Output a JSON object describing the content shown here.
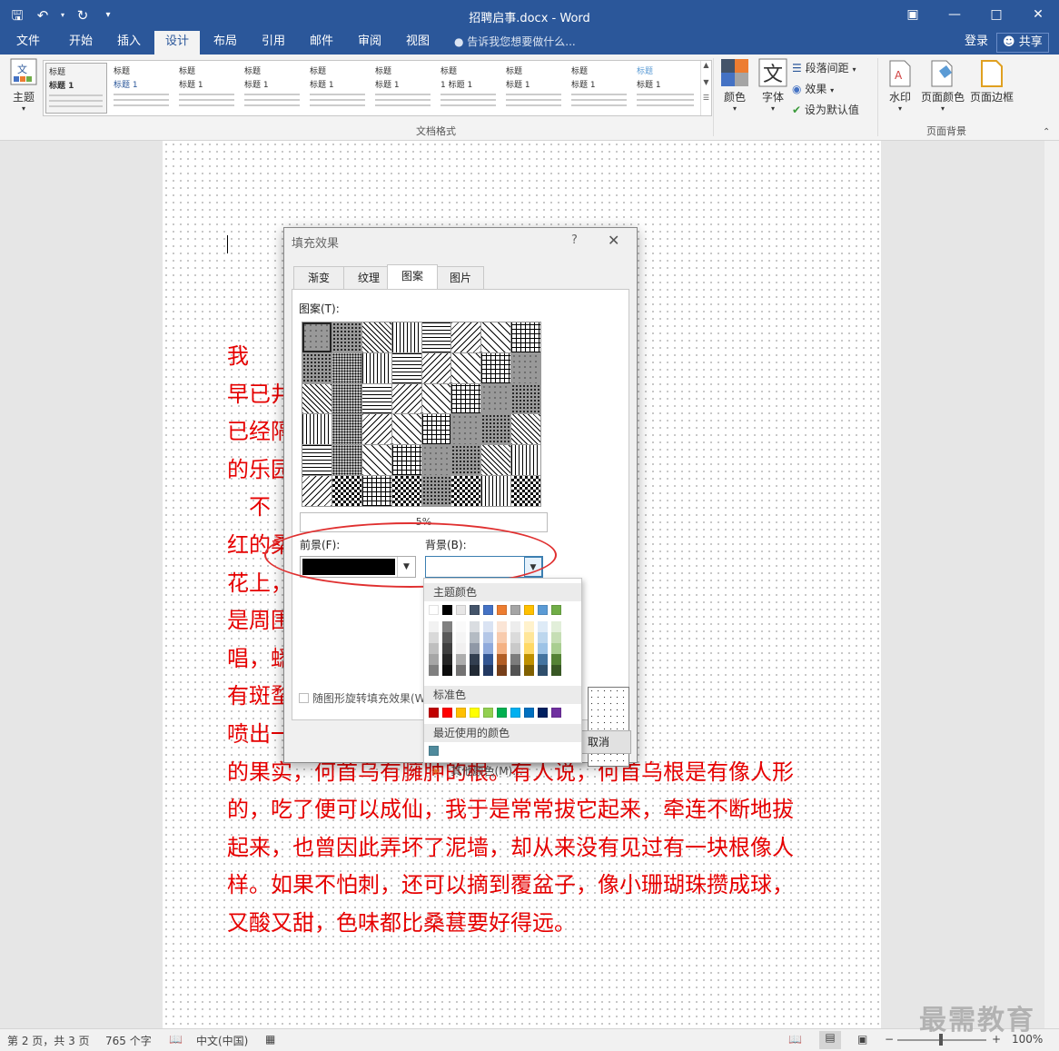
{
  "app": {
    "title": "招聘启事.docx - Word",
    "quick_access": [
      "save-icon",
      "undo-icon",
      "redo-icon",
      "customize-icon"
    ],
    "window_controls": [
      "restore-ribbon-icon",
      "minimize-icon",
      "maximize-icon",
      "close-icon"
    ]
  },
  "tabs": [
    {
      "label": "文件",
      "active": false
    },
    {
      "label": "开始",
      "active": false
    },
    {
      "label": "插入",
      "active": false
    },
    {
      "label": "设计",
      "active": true
    },
    {
      "label": "布局",
      "active": false
    },
    {
      "label": "引用",
      "active": false
    },
    {
      "label": "邮件",
      "active": false
    },
    {
      "label": "审阅",
      "active": false
    },
    {
      "label": "视图",
      "active": false
    }
  ],
  "tellme": "告诉我您想要做什么...",
  "account": {
    "login": "登录",
    "share": "共享"
  },
  "ribbon": {
    "theme_label": "主题",
    "gallery": [
      {
        "h1": "标题",
        "h2": "标题 1"
      },
      {
        "h1": "标题",
        "h2": "标题 1"
      },
      {
        "h1": "标题",
        "h2": "标题 1"
      },
      {
        "h1": "标题",
        "h2": "标题 1"
      },
      {
        "h1": "标题",
        "h2": "标题 1"
      },
      {
        "h1": "标题",
        "h2": "标题 1"
      },
      {
        "h1": "标题",
        "h2": "1 标题 1"
      },
      {
        "h1": "标题",
        "h2": "标题 1"
      },
      {
        "h1": "标题",
        "h2": "标题 1"
      },
      {
        "h1": "标题",
        "h2": "标题 1"
      }
    ],
    "colors_label": "颜色",
    "fonts_label": "字体",
    "para_spacing": "段落间距",
    "effects": "效果",
    "set_default": "设为默认值",
    "group_format": "文档格式",
    "watermark": "水印",
    "page_color": "页面颜色",
    "page_border": "页面边框",
    "group_bg": "页面背景"
  },
  "document": {
    "lines": [
      "我                                  百草园。现在是",
      "早已井                              那最末次的相见也",
      "已经隔                              些草;但那时却是我",
      "的乐园",
      "    不                               高大的皂荚树，紫",
      "红的桑                              肥胖的黄蜂伏在菜",
      "花上，                              向云霄里去了。单",
      "是周围                              味。油蛉在这里低",
      "唱，蟋                              时会遇见蜈蚣；还",
      "有斑蝥                              啪的一声，从后窍",
      "喷出一                              木莲有莲房一般",
      "的果实，何首乌有臃肿的根。有人说，何首乌根是有像人形",
      "的，吃了便可以成仙，我于是常常拔它起来，牵连不断地拔",
      "起来，也曾因此弄坏了泥墙，却从来没有见过有一块根像人",
      "样。如果不怕刺，还可以摘到覆盆子，像小珊瑚珠攒成球，",
      "又酸又甜，色味都比桑葚要好得远。"
    ]
  },
  "dialog": {
    "title": "填充效果",
    "help": "?",
    "tabs": [
      {
        "label": "渐变",
        "active": false
      },
      {
        "label": "纹理",
        "active": false
      },
      {
        "label": "图案",
        "active": true
      },
      {
        "label": "图片",
        "active": false
      }
    ],
    "pattern_label": "图案(T):",
    "pattern_name": "5%",
    "fg_label": "前景(F):",
    "bg_label": "背景(B):",
    "fg_color": "#000000",
    "rotate_label": "随图形旋转填充效果(W)",
    "cancel": "取消"
  },
  "color_dropdown": {
    "theme_header": "主题颜色",
    "theme_colors": [
      "#ffffff",
      "#000000",
      "#e7e6e6",
      "#44546a",
      "#4472c4",
      "#ed7d31",
      "#a5a5a5",
      "#ffc000",
      "#5b9bd5",
      "#70ad47"
    ],
    "standard_header": "标准色",
    "standard_colors": [
      "#c00000",
      "#ff0000",
      "#ffc000",
      "#ffff00",
      "#92d050",
      "#00b050",
      "#00b0f0",
      "#0070c0",
      "#002060",
      "#7030a0"
    ],
    "recent_header": "最近使用的颜色",
    "recent_colors": [
      "#4f8a9c"
    ],
    "more": "其他颜色(M)..."
  },
  "status": {
    "page": "第 2 页，共 3 页",
    "words": "765 个字",
    "lang": "中文(中国)",
    "zoom": "100%"
  },
  "watermark_text": "最需教育"
}
